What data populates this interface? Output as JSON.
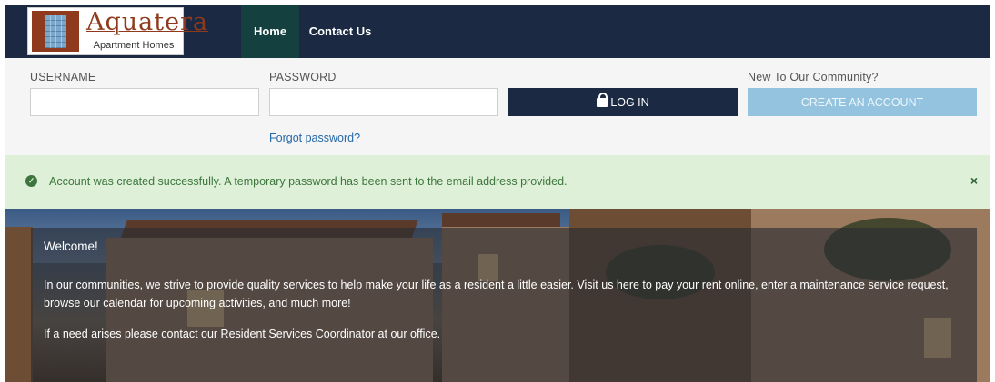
{
  "brand": {
    "name": "Aquatera",
    "tagline": "Apartment Homes"
  },
  "nav": {
    "home": "Home",
    "contact": "Contact Us"
  },
  "login": {
    "username_label": "USERNAME",
    "username_value": "",
    "password_label": "PASSWORD",
    "password_value": "",
    "login_button": "LOG IN",
    "new_label": "New To Our Community?",
    "create_button": "CREATE AN ACCOUNT",
    "forgot_link": "Forgot password?"
  },
  "alert": {
    "message": "Account was created successfully. A temporary password has been sent to the email address provided.",
    "close_symbol": "×"
  },
  "hero": {
    "title": "Welcome!",
    "paragraph1": "In our communities, we strive to provide quality services to help make your life as a resident a little easier. Visit us here to pay your rent online, enter a maintenance service request, browse our calendar for upcoming activities, and much more!",
    "paragraph2": "If a need arises please contact our Resident Services Coordinator at our office."
  },
  "colors": {
    "navbar": "#1b2a42",
    "nav_active": "#14403f",
    "login_button": "#1b2a42",
    "create_button": "#93c3de",
    "alert_bg": "#dff0d8",
    "alert_text": "#3c763d",
    "link": "#2668a8"
  },
  "icons": {
    "lock": "lock-icon",
    "success": "check-circle-icon",
    "close": "close-icon"
  }
}
